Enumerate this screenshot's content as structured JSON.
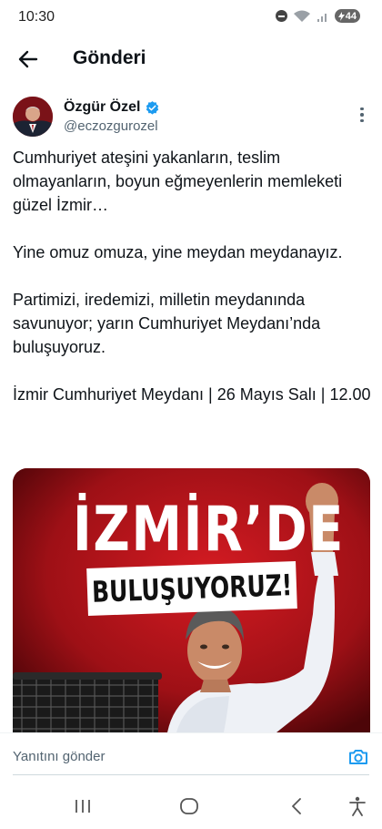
{
  "status_bar": {
    "time": "10:30",
    "battery_level": "44"
  },
  "header": {
    "title": "Gönderi"
  },
  "author": {
    "display_name": "Özgür Özel",
    "handle": "@eczozgurozel",
    "verified": true
  },
  "tweet": {
    "paragraphs": [
      "Cumhuriyet ateşini yakanların, teslim olmayanların, boyun eğmeyenlerin memleketi güzel İzmir…",
      "Yine omuz omuza, yine meydan meydanayız.",
      "Partimizi, iredemizi, milletin meydanında savunuyor; yarın Cumhuriyet Meydanı’nda buluşuyoruz.",
      "İzmir Cumhuriyet Meydanı | 26 Mayıs Salı | 12.00"
    ]
  },
  "media": {
    "headline": "İZMİR’DE",
    "banner": "BULUŞUYORUZ!"
  },
  "reply": {
    "placeholder": "Yanıtını gönder"
  },
  "colors": {
    "media_red": "#8f0d12",
    "verified_blue": "#1d9bf0",
    "camera_blue": "#1d9bf0",
    "muted_text": "#536471"
  },
  "icons": {
    "back": "arrow-left-icon",
    "verified": "verified-badge-icon",
    "more": "more-vertical-icon",
    "camera": "camera-icon",
    "recents": "recents-icon",
    "home": "home-icon",
    "nav_back": "chevron-left-icon",
    "accessibility": "accessibility-icon"
  }
}
